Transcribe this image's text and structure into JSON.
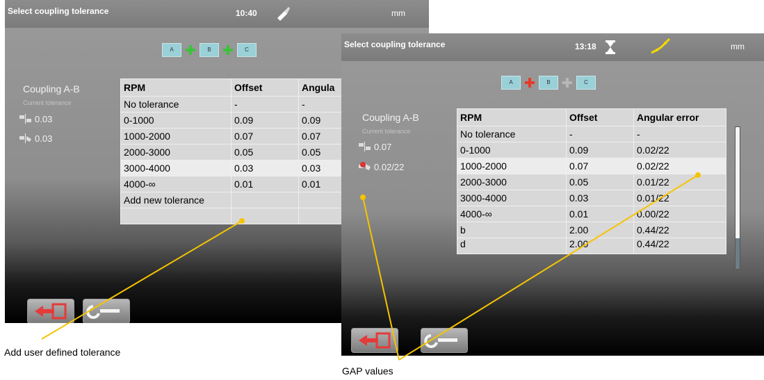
{
  "screens": [
    {
      "title": "Select coupling tolerance",
      "time": "10:40",
      "unit": "mm",
      "selector": [
        "A",
        "B",
        "C"
      ],
      "coupling_label": "Coupling A-B",
      "current_tolerance_label": "Current tolerance",
      "offset_value": "0.03",
      "angular_value": "0.03",
      "table": {
        "headers": [
          "RPM",
          "Offset",
          "Angula"
        ],
        "rows": [
          [
            "No tolerance",
            "-",
            "-"
          ],
          [
            "0-1000",
            "0.09",
            "0.09"
          ],
          [
            "1000-2000",
            "0.07",
            "0.07"
          ],
          [
            "2000-3000",
            "0.05",
            "0.05"
          ],
          [
            "3000-4000",
            "0.03",
            "0.03"
          ],
          [
            "4000-∞",
            "0.01",
            "0.01"
          ],
          [
            "Add new tolerance",
            "",
            ""
          ]
        ]
      }
    },
    {
      "title": "Select coupling tolerance",
      "time": "13:18",
      "unit": "mm",
      "selector": [
        "A",
        "B",
        "C"
      ],
      "coupling_label": "Coupling A-B",
      "current_tolerance_label": "Current tolerance",
      "offset_value": "0.07",
      "angular_value": "0.02/22",
      "table": {
        "headers": [
          "RPM",
          "Offset",
          "Angular error"
        ],
        "rows": [
          [
            "No tolerance",
            "-",
            "-"
          ],
          [
            "0-1000",
            "0.09",
            "0.02/22"
          ],
          [
            "1000-2000",
            "0.07",
            "0.02/22"
          ],
          [
            "2000-3000",
            "0.05",
            "0.01/22"
          ],
          [
            "3000-4000",
            "0.03",
            "0.01/22"
          ],
          [
            "4000-∞",
            "0.01",
            "0.00/22"
          ],
          [
            "b",
            "2.00",
            "0.44/22"
          ],
          [
            "d",
            "2.00",
            "0.44/22"
          ]
        ]
      }
    }
  ],
  "annotations": {
    "add_user_defined": "Add user defined tolerance",
    "gap_values": "GAP values"
  },
  "colors": {
    "callout_line": "#f5c400",
    "selected_green": "#3cc23c",
    "selected_red": "#e83a2a",
    "selector_box": "#9ad0d8"
  }
}
